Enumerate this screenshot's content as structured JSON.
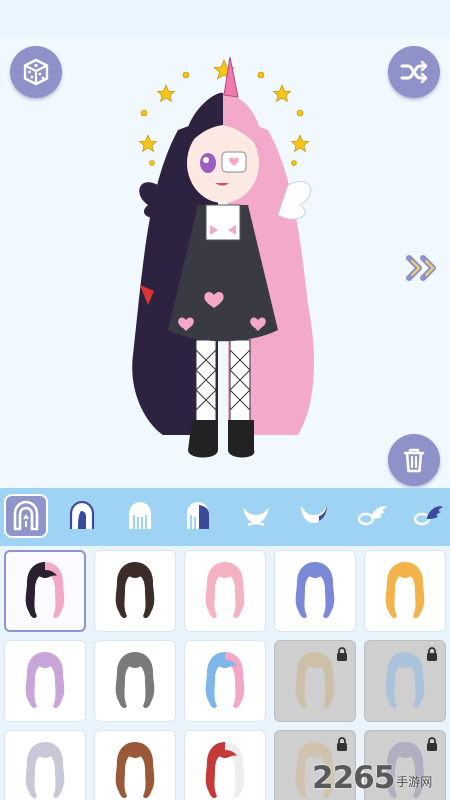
{
  "toolbar": {
    "random_icon": "dice-icon",
    "shuffle_icon": "shuffle-icon",
    "next_icon": "double-chevron-right-icon",
    "trash_icon": "trash-icon"
  },
  "colors": {
    "accent": "#8f92c9",
    "tabbar": "#9fd3f4",
    "background": "#eef6fc",
    "locked_cell": "#cfcfcf"
  },
  "tabs": [
    {
      "icon": "hair-full-icon",
      "active": true
    },
    {
      "icon": "hair-front-icon",
      "active": false
    },
    {
      "icon": "hair-back-icon",
      "active": false
    },
    {
      "icon": "hair-side-icon",
      "active": false
    },
    {
      "icon": "horns-icon",
      "active": false
    },
    {
      "icon": "horns-alt-icon",
      "active": false
    },
    {
      "icon": "wings-icon",
      "active": false
    },
    {
      "icon": "wings-alt-icon",
      "active": false
    }
  ],
  "hair_items": [
    {
      "colors": [
        "#2a2030",
        "#f2a9c8"
      ],
      "locked": false,
      "selected": true
    },
    {
      "colors": [
        "#3a2d2a"
      ],
      "locked": false,
      "selected": false
    },
    {
      "colors": [
        "#f4b2c2"
      ],
      "locked": false,
      "selected": false
    },
    {
      "colors": [
        "#7b88d8"
      ],
      "locked": false,
      "selected": false
    },
    {
      "colors": [
        "#f3b24a"
      ],
      "locked": false,
      "selected": false
    },
    {
      "colors": [
        "#c9a6d9"
      ],
      "locked": false,
      "selected": false
    },
    {
      "colors": [
        "#7a7a7a"
      ],
      "locked": false,
      "selected": false
    },
    {
      "colors": [
        "#7fb6ea",
        "#f3a6c6"
      ],
      "locked": false,
      "selected": false
    },
    {
      "colors": [
        "#c9b07a"
      ],
      "locked": true,
      "selected": false
    },
    {
      "colors": [
        "#7fb6ea"
      ],
      "locked": true,
      "selected": false
    },
    {
      "colors": [
        "#c8c8d6"
      ],
      "locked": false,
      "selected": false
    },
    {
      "colors": [
        "#9a5a3a"
      ],
      "locked": false,
      "selected": false
    },
    {
      "colors": [
        "#c43a3a",
        "#eeeeee"
      ],
      "locked": false,
      "selected": false
    },
    {
      "colors": [
        "#d0b58a"
      ],
      "locked": true,
      "selected": false
    },
    {
      "colors": [
        "#8a8ab0"
      ],
      "locked": true,
      "selected": false
    }
  ],
  "watermark": {
    "number": "2265",
    "suffix": "手游网"
  }
}
